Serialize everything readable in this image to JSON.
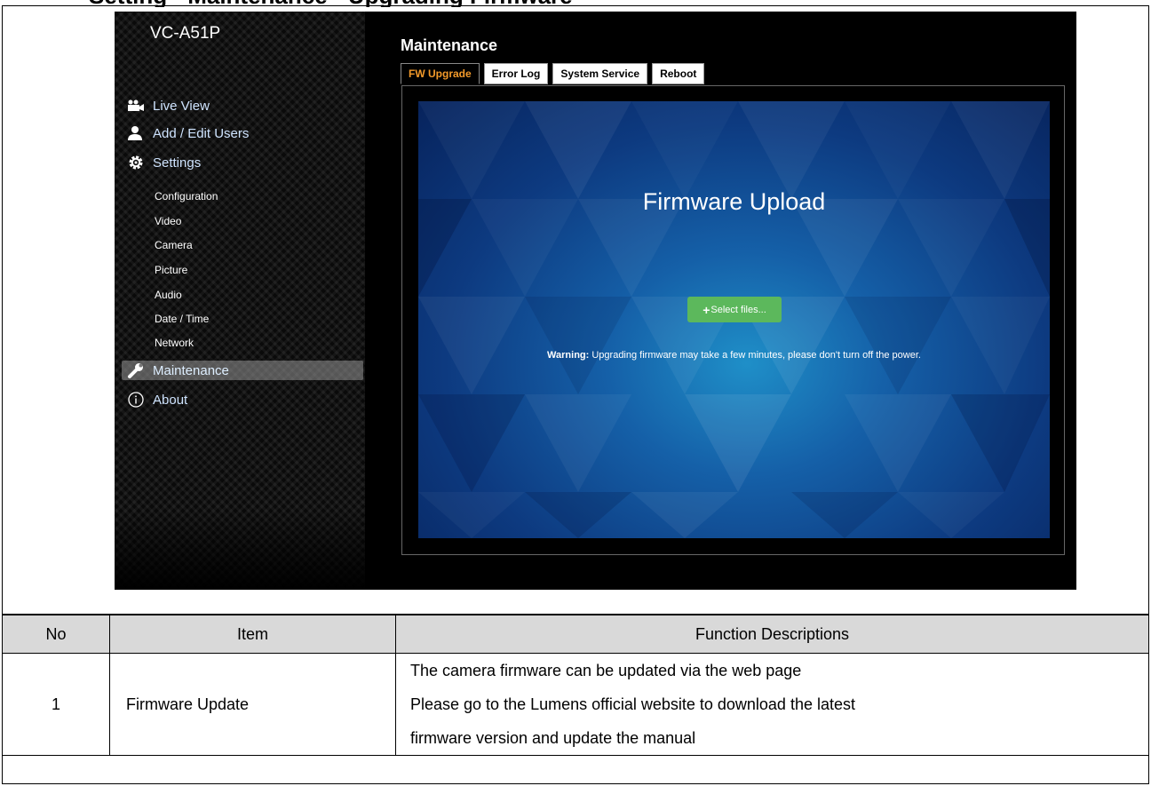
{
  "document": {
    "heading": "Setting - Maintenance - Upgrading Firmware"
  },
  "app": {
    "model": "VC-A51P",
    "nav": {
      "live_view": "Live View",
      "add_edit_users": "Add / Edit Users",
      "settings": "Settings",
      "sub_items": [
        "Configuration",
        "Video",
        "Camera",
        "Picture",
        "Audio",
        "Date / Time",
        "Network"
      ],
      "maintenance": "Maintenance",
      "about": "About"
    },
    "page_title": "Maintenance",
    "tabs": [
      "FW Upgrade",
      "Error Log",
      "System Service",
      "Reboot"
    ],
    "active_tab": "FW Upgrade",
    "upload": {
      "title": "Firmware Upload",
      "button": "Select files...",
      "warning_label": "Warning:",
      "warning_text": "Upgrading firmware may take a few minutes, please don't turn off the power."
    }
  },
  "table": {
    "headers": [
      "No",
      "Item",
      "Function Descriptions"
    ],
    "rows": [
      {
        "no": "1",
        "item": "Firmware Update",
        "lines": [
          "The camera firmware can be updated via the web page",
          "Please go to the Lumens official website to download the latest",
          "firmware version and update the manual"
        ]
      }
    ]
  },
  "colors": {
    "active_tab_text": "#f39a2a",
    "select_button": "#5cb85c",
    "header_bg": "#d9d9d9"
  }
}
